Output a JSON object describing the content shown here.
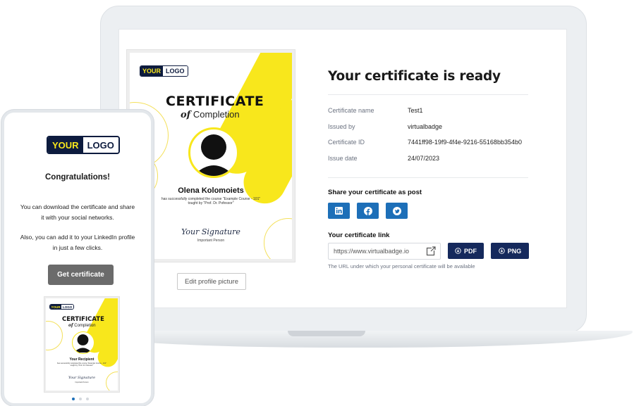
{
  "certificate_preview": {
    "logo_left": "YOUR",
    "logo_right": "LOGO",
    "title": "CERTIFICATE",
    "subtitle_of": "of",
    "subtitle_rest": "Completion",
    "recipient": "Olena Kolomoiets",
    "description_line1": "has successfully completed the course \"Example Course - 101\"",
    "description_line2": "tought by \"Prof. Dr. Pofessor\"",
    "signature": "Your Signature",
    "signer_role": "Important Person"
  },
  "edit_button": "Edit profile picture",
  "panel": {
    "title": "Your certificate is ready",
    "details": [
      {
        "label": "Certificate name",
        "value": "Test1"
      },
      {
        "label": "Issued by",
        "value": "virtualbadge"
      },
      {
        "label": "Certificate ID",
        "value": "7441ff98-19f9-4f4e-9216-55168bb354b0"
      },
      {
        "label": "Issue date",
        "value": "24/07/2023"
      }
    ],
    "share_title": "Share your certificate as post",
    "share_buttons": [
      "linkedin-icon",
      "facebook-icon",
      "twitter-icon"
    ],
    "link_title": "Your certificate link",
    "link_value": "https://www.virtualbadge.io",
    "pdf_label": "PDF",
    "png_label": "PNG",
    "hint": "The URL under which your personal certificate will be available"
  },
  "phone": {
    "logo_left": "YOUR",
    "logo_right": "LOGO",
    "congrats": "Congratulations!",
    "text1_line1": "You can download the certificate and share",
    "text1_line2": "it with your social networks.",
    "text2_line1": "Also, you can add it to your LinkedIn profile",
    "text2_line2": "in just a few clicks.",
    "get_button": "Get certificate",
    "mini_cert": {
      "logo_left": "YOUR",
      "logo_right": "LOGO",
      "title": "CERTIFICATE",
      "subtitle_of": "of",
      "subtitle_rest": "Completion",
      "recipient": "Your Recipient",
      "description_line1": "has successfully completed the course \"Example Course - 101\"",
      "description_line2": "tought by \"Prof. Dr. Pofessor\"",
      "signature": "Your Signature",
      "signer_role": "Important Person"
    }
  },
  "colors": {
    "accent_yellow": "#f8e71c",
    "navy": "#15295c",
    "social_blue": "#1d6fb8",
    "button_gray": "#6b6b6b"
  }
}
